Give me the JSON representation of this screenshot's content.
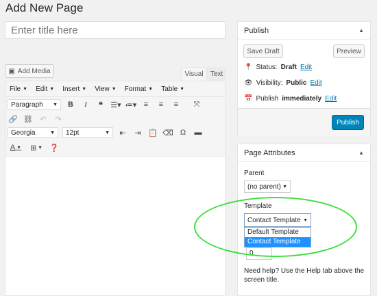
{
  "page_title": "Add New Page",
  "title_placeholder": "Enter title here",
  "editor": {
    "add_media_label": "Add Media",
    "tabs": {
      "visual": "Visual",
      "text": "Text"
    },
    "menubar": [
      "File",
      "Edit",
      "Insert",
      "View",
      "Format",
      "Table"
    ],
    "format_select": "Paragraph",
    "font_select": "Georgia",
    "size_select": "12pt"
  },
  "publish": {
    "title": "Publish",
    "save_draft": "Save Draft",
    "preview": "Preview",
    "status_label": "Status:",
    "status_value": "Draft",
    "visibility_label": "Visibility:",
    "visibility_value": "Public",
    "publish_label": "Publish",
    "publish_value": "immediately",
    "edit_label": "Edit",
    "publish_button": "Publish"
  },
  "attributes": {
    "title": "Page Attributes",
    "parent_label": "Parent",
    "parent_value": "(no parent)",
    "template_label": "Template",
    "template_value": "Contact Template",
    "template_options": [
      "Default Template",
      "Contact Template"
    ],
    "order_value": "0",
    "help_text": "Need help? Use the Help tab above the screen title."
  },
  "colors": {
    "accent": "#0085ba",
    "link": "#0073aa",
    "highlight": "#3be03b",
    "selected_option": "#1e90ff"
  }
}
